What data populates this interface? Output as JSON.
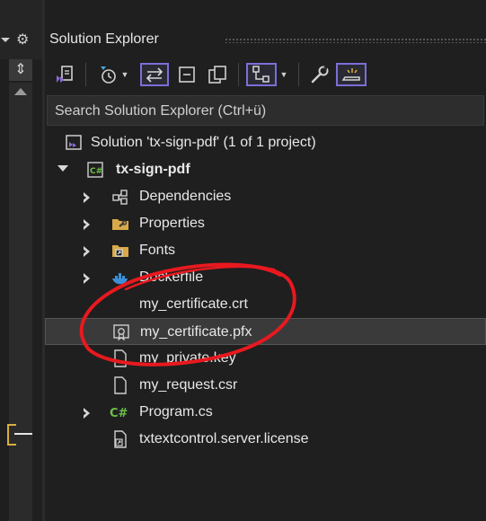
{
  "panel": {
    "title": "Solution Explorer",
    "search_placeholder": "Search Solution Explorer (Ctrl+ü)"
  },
  "toolbar": {
    "icons": [
      "vs-solution-switch-icon",
      "history-icon",
      "sync-icon",
      "collapse-all-icon",
      "copy-icon",
      "hierarchy-view-icon",
      "wrench-icon",
      "preview-icon"
    ]
  },
  "left_strip": {
    "split_glyph": "⇕",
    "gear_glyph": "⚙"
  },
  "tree": {
    "solution": "Solution 'tx-sign-pdf' (1 of 1 project)",
    "project": "tx-sign-pdf",
    "items": [
      {
        "label": "Dependencies"
      },
      {
        "label": "Properties"
      },
      {
        "label": "Fonts"
      },
      {
        "label": "Dockerfile"
      },
      {
        "label": "my_certificate.crt"
      },
      {
        "label": "my_certificate.pfx"
      },
      {
        "label": "my_private.key"
      },
      {
        "label": "my_request.csr"
      },
      {
        "label": "Program.cs"
      },
      {
        "label": "txtextcontrol.server.license"
      }
    ]
  },
  "colors": {
    "accent": "#7b6fd8",
    "annotation_red": "#e8191f",
    "folder": "#d9a949",
    "csharp_green": "#6cc04a"
  }
}
